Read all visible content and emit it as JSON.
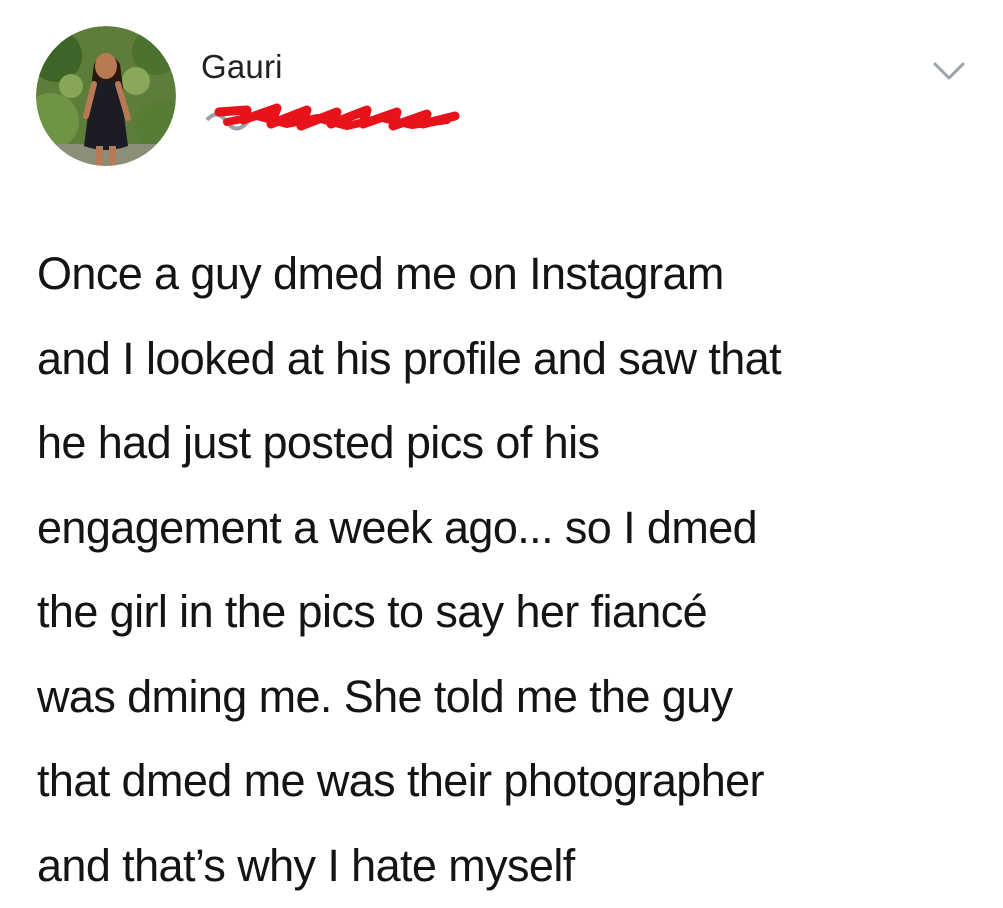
{
  "tweet": {
    "author": {
      "display_name": "Gauri",
      "avatar_icon": "profile-photo",
      "handle_redaction_color": "#e8121b"
    },
    "menu_icon": "chevron-down-icon",
    "body_text": "Once a guy dmed me on Instagram\nand I looked at his profile and saw that\nhe had just posted pics of his\nengagement a week ago... so I dmed\nthe girl in the pics to say her fiancé\nwas dming me. She told me the guy\nthat dmed me was their photographer\nand that’s why I hate myself"
  }
}
